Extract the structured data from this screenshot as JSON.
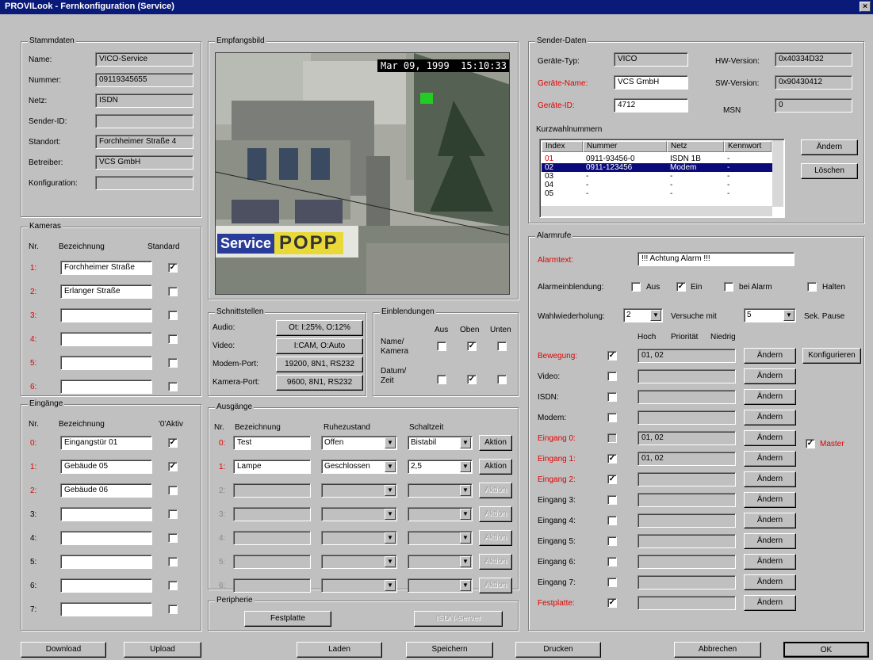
{
  "window": {
    "title": "PROVILook - Fernkonfiguration (Service)",
    "close": "×"
  },
  "stammdaten": {
    "title": "Stammdaten",
    "rows": [
      {
        "label": "Name:",
        "value": "VICO-Service"
      },
      {
        "label": "Nummer:",
        "value": "09119345655"
      },
      {
        "label": "Netz:",
        "value": "ISDN"
      },
      {
        "label": "Sender-ID:",
        "value": ""
      },
      {
        "label": "Standort:",
        "value": "Forchheimer Straße 4"
      },
      {
        "label": "Betreiber:",
        "value": "VCS GmbH"
      },
      {
        "label": "Konfiguration:",
        "value": ""
      }
    ]
  },
  "kameras": {
    "title": "Kameras",
    "col_nr": "Nr.",
    "col_name": "Bezeichnung",
    "col_std": "Standard",
    "rows": [
      {
        "nr": "1:",
        "name": "Forchheimer Straße",
        "std": "✓"
      },
      {
        "nr": "2:",
        "name": "Erlanger Straße",
        "std": ""
      },
      {
        "nr": "3:",
        "name": "",
        "std": ""
      },
      {
        "nr": "4:",
        "name": "",
        "std": ""
      },
      {
        "nr": "5:",
        "name": "",
        "std": ""
      },
      {
        "nr": "6:",
        "name": "",
        "std": ""
      }
    ]
  },
  "eingaenge": {
    "title": "Eingänge",
    "col_nr": "Nr.",
    "col_name": "Bezeichnung",
    "col_aktiv": "'0'Aktiv",
    "rows": [
      {
        "nr": "0:",
        "name": "Eingangstür 01",
        "aktiv": "✓"
      },
      {
        "nr": "1:",
        "name": "Gebäude 05",
        "aktiv": "✓"
      },
      {
        "nr": "2:",
        "name": "Gebäude 06",
        "aktiv": ""
      },
      {
        "nr": "3:",
        "name": "",
        "aktiv": ""
      },
      {
        "nr": "4:",
        "name": "",
        "aktiv": ""
      },
      {
        "nr": "5:",
        "name": "",
        "aktiv": ""
      },
      {
        "nr": "6:",
        "name": "",
        "aktiv": ""
      },
      {
        "nr": "7:",
        "name": "",
        "aktiv": ""
      }
    ]
  },
  "empfangsbild": {
    "title": "Empfangsbild",
    "timestamp": "Mar 09, 1999  15:10:33",
    "sign1": "Service",
    "sign2": "POPP"
  },
  "schnittstellen": {
    "title": "Schnittstellen",
    "rows": [
      {
        "label": "Audio:",
        "value": "Ot: I:25%, O:12%"
      },
      {
        "label": "Video:",
        "value": "I:CAM, O:Auto"
      },
      {
        "label": "Modem-Port:",
        "value": "19200, 8N1, RS232"
      },
      {
        "label": "Kamera-Port:",
        "value": "9600, 8N1, RS232"
      }
    ]
  },
  "einblendungen": {
    "title": "Einblendungen",
    "col_aus": "Aus",
    "col_oben": "Oben",
    "col_unten": "Unten",
    "row1": "Name/ Kamera",
    "row2": "Datum/ Zeit",
    "row1_checks": [
      "",
      "✓",
      ""
    ],
    "row2_checks": [
      "",
      "✓",
      ""
    ]
  },
  "ausgaenge": {
    "title": "Ausgänge",
    "col_nr": "Nr.",
    "col_name": "Bezeichnung",
    "col_ruhe": "Ruhezustand",
    "col_schalt": "Schaltzeit",
    "action": "Aktion",
    "rows": [
      {
        "nr": "0:",
        "name": "Test",
        "ruhe": "Offen",
        "schalt": "Bistabil"
      },
      {
        "nr": "1:",
        "name": "Lampe",
        "ruhe": "Geschlossen",
        "schalt": "2,5"
      },
      {
        "nr": "2:",
        "name": "",
        "ruhe": "",
        "schalt": ""
      },
      {
        "nr": "3:",
        "name": "",
        "ruhe": "",
        "schalt": ""
      },
      {
        "nr": "4:",
        "name": "",
        "ruhe": "",
        "schalt": ""
      },
      {
        "nr": "5:",
        "name": "",
        "ruhe": "",
        "schalt": ""
      },
      {
        "nr": "6:",
        "name": "",
        "ruhe": "",
        "schalt": ""
      }
    ]
  },
  "peripherie": {
    "title": "Peripherie",
    "festplatte": "Festplatte",
    "isdn_server": "ISDN-Server"
  },
  "senderdaten": {
    "title": "Sender-Daten",
    "geraetetyp_label": "Geräte-Typ:",
    "geraetetyp": "VICO",
    "geraetename_label": "Geräte-Name:",
    "geraetename": "VCS GmbH",
    "geraeteid_label": "Geräte-ID:",
    "geraeteid": "4712",
    "hw_label": "HW-Version:",
    "hw": "0x40334D32",
    "sw_label": "SW-Version:",
    "sw": "0x90430412",
    "msn_label": "MSN",
    "msn": "0"
  },
  "kurzwahl": {
    "title": "Kurzwahlnummern",
    "headers": [
      "Index",
      "Nummer",
      "Netz",
      "Kennwort"
    ],
    "rows": [
      {
        "idx": "01",
        "nummer": "0911-93456-0",
        "netz": "ISDN 1B",
        "kw": "-"
      },
      {
        "idx": "02",
        "nummer": "0911-123456",
        "netz": "Modem",
        "kw": "-"
      },
      {
        "idx": "03",
        "nummer": "-",
        "netz": "-",
        "kw": "-"
      },
      {
        "idx": "04",
        "nummer": "-",
        "netz": "-",
        "kw": "-"
      },
      {
        "idx": "05",
        "nummer": "-",
        "netz": "-",
        "kw": "-"
      }
    ],
    "aendern": "Ändern",
    "loeschen": "Löschen"
  },
  "alarmrufe": {
    "title": "Alarmrufe",
    "alarmtext_label": "Alarmtext:",
    "alarmtext": "!!! Achtung Alarm !!!",
    "einblendung_label": "Alarmeinblendung:",
    "opt_aus": "Aus",
    "opt_ein": "Ein",
    "opt_bei": "bei Alarm",
    "opt_halten": "Halten",
    "opt_checks": [
      "",
      "✓",
      "",
      ""
    ],
    "wahl_label": "Wahlwiederholung:",
    "wahl_value": "2",
    "versuche_label": "Versuche mit",
    "pause_value": "5",
    "pause_label": "Sek. Pause",
    "col_hoch": "Hoch",
    "col_prio": "Priorität",
    "col_niedrig": "Niedrig",
    "aendern": "Ändern",
    "konfigurieren": "Konfigurieren",
    "master": "Master",
    "master_check": "✓",
    "rows": [
      {
        "label": "Bewegung:",
        "check": "✓",
        "value": "01, 02"
      },
      {
        "label": "Video:",
        "check": "",
        "value": ""
      },
      {
        "label": "ISDN:",
        "check": "",
        "value": ""
      },
      {
        "label": "Modem:",
        "check": "",
        "value": ""
      },
      {
        "label": "Eingang 0:",
        "check": "",
        "value": "01, 02"
      },
      {
        "label": "Eingang 1:",
        "check": "✓",
        "value": "01, 02"
      },
      {
        "label": "Eingang 2:",
        "check": "✓",
        "value": ""
      },
      {
        "label": "Eingang 3:",
        "check": "",
        "value": ""
      },
      {
        "label": "Eingang 4:",
        "check": "",
        "value": ""
      },
      {
        "label": "Eingang 5:",
        "check": "",
        "value": ""
      },
      {
        "label": "Eingang 6:",
        "check": "",
        "value": ""
      },
      {
        "label": "Eingang 7:",
        "check": "",
        "value": ""
      },
      {
        "label": "Festplatte:",
        "check": "✓",
        "value": ""
      }
    ]
  },
  "footer": {
    "download": "Download",
    "upload": "Upload",
    "laden": "Laden",
    "speichern": "Speichern",
    "drucken": "Drucken",
    "abbrechen": "Abbrechen",
    "ok": "OK"
  }
}
